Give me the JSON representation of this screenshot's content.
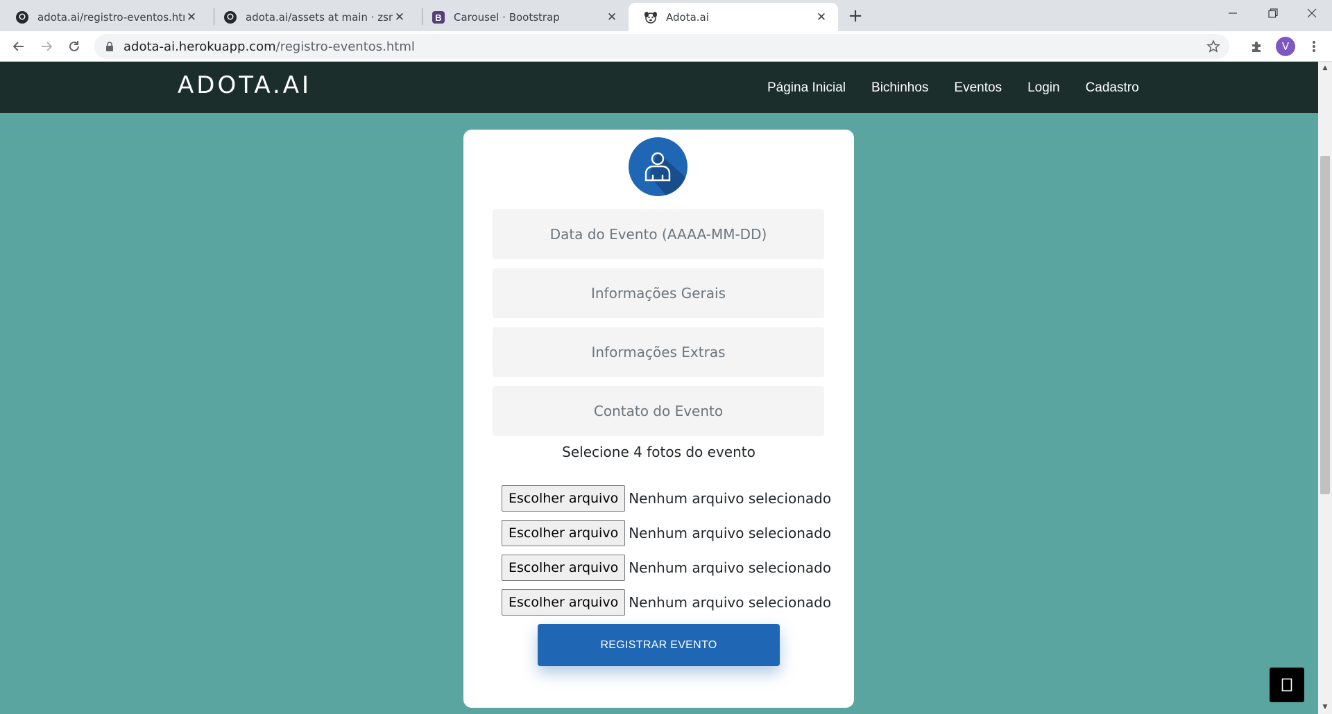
{
  "browser": {
    "tabs": [
      {
        "title": "adota.ai/registro-eventos.html at",
        "icon": "github-icon",
        "active": false
      },
      {
        "title": "adota.ai/assets at main · zsmn/ac",
        "icon": "github-icon",
        "active": false
      },
      {
        "title": "Carousel · Bootstrap",
        "icon": "bootstrap-icon",
        "active": false
      },
      {
        "title": "Adota.ai",
        "icon": "dog-icon",
        "active": true
      }
    ],
    "url_host": "adota-ai.herokuapp.com",
    "url_path": "/registro-eventos.html",
    "profile_initial": "V"
  },
  "site": {
    "brand": "ADOTA.AI",
    "nav": [
      "Página Inicial",
      "Bichinhos",
      "Eventos",
      "Login",
      "Cadastro"
    ]
  },
  "form": {
    "fields": [
      "Data do Evento (AAAA-MM-DD)",
      "Informações Gerais",
      "Informações Extras",
      "Contato do Evento"
    ],
    "photos_label": "Selecione 4 fotos do evento",
    "file_inputs": [
      {
        "button": "Escolher arquivo",
        "status": "Nenhum arquivo selecionado"
      },
      {
        "button": "Escolher arquivo",
        "status": "Nenhum arquivo selecionado"
      },
      {
        "button": "Escolher arquivo",
        "status": "Nenhum arquivo selecionado"
      },
      {
        "button": "Escolher arquivo",
        "status": "Nenhum arquivo selecionado"
      }
    ],
    "submit": "REGISTRAR EVENTO"
  },
  "colors": {
    "page_bg": "#5aa5a0",
    "navbar": "#1b2e2c",
    "primary": "#1f66b4"
  }
}
